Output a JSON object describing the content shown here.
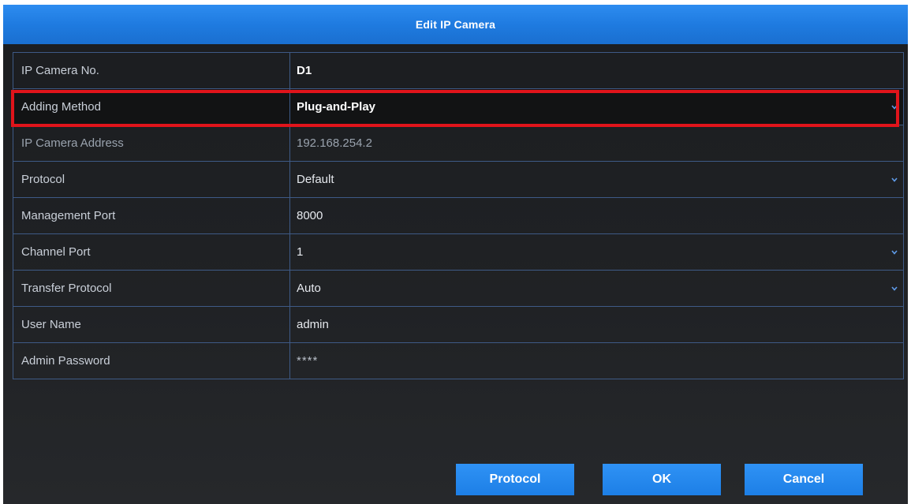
{
  "dialog": {
    "title": "Edit IP Camera"
  },
  "form": {
    "rows": [
      {
        "label": "IP Camera No.",
        "value": "D1",
        "dropdown": false
      },
      {
        "label": "Adding Method",
        "value": "Plug-and-Play",
        "dropdown": true
      },
      {
        "label": "IP Camera Address",
        "value": "192.168.254.2",
        "dropdown": false
      },
      {
        "label": "Protocol",
        "value": "Default",
        "dropdown": true
      },
      {
        "label": "Management Port",
        "value": "8000",
        "dropdown": false
      },
      {
        "label": "Channel Port",
        "value": "1",
        "dropdown": true
      },
      {
        "label": "Transfer Protocol",
        "value": "Auto",
        "dropdown": true
      },
      {
        "label": "User Name",
        "value": "admin",
        "dropdown": false
      },
      {
        "label": "Admin Password",
        "value": "****",
        "dropdown": false
      }
    ]
  },
  "buttons": {
    "protocol": "Protocol",
    "ok": "OK",
    "cancel": "Cancel"
  },
  "colors": {
    "accent": "#1f7be0",
    "highlight": "#e0141b",
    "border": "#3e5a86",
    "background": "#1e2023"
  },
  "icons": {
    "dropdown": "chevron-down-icon"
  }
}
